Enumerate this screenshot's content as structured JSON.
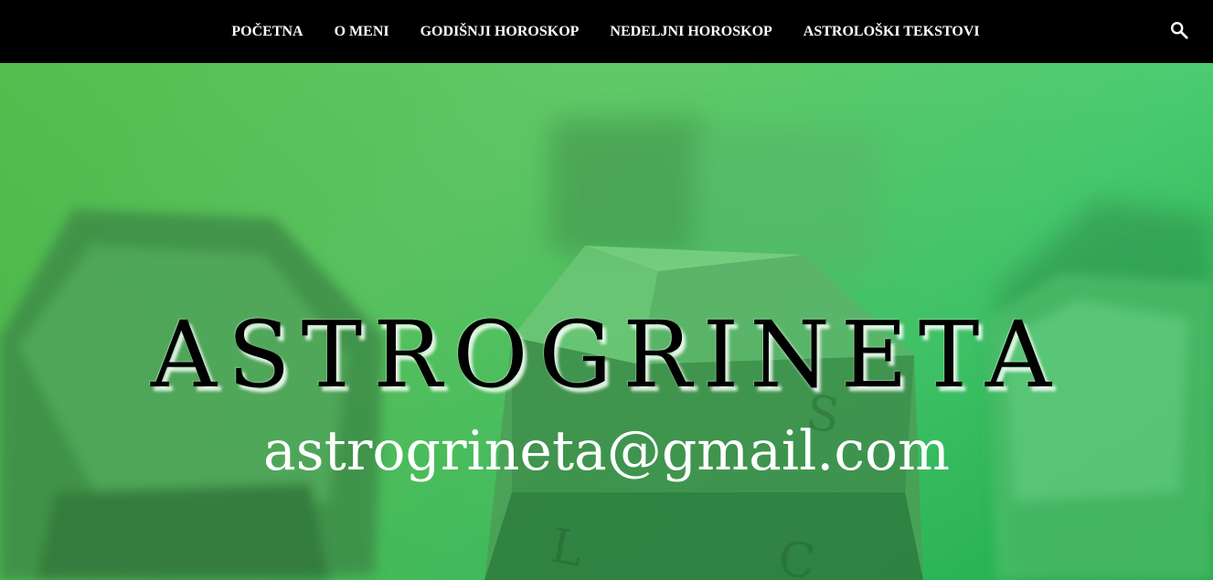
{
  "nav": {
    "items": [
      {
        "label": "POČETNA"
      },
      {
        "label": "O MENI"
      },
      {
        "label": "GODIŠNJI HOROSKOP"
      },
      {
        "label": "NEDELJNI HOROSKOP"
      },
      {
        "label": "ASTROLOŠKI TEKSTOVI"
      }
    ],
    "search_icon": "search-icon"
  },
  "hero": {
    "title": "ASTROGRINETA",
    "subtitle": "astrogrineta@gmail.com"
  },
  "colors": {
    "nav_bg": "#000000",
    "hero_green": "#4cc25a",
    "title_color": "#000000",
    "subtitle_color": "#ffffff"
  }
}
